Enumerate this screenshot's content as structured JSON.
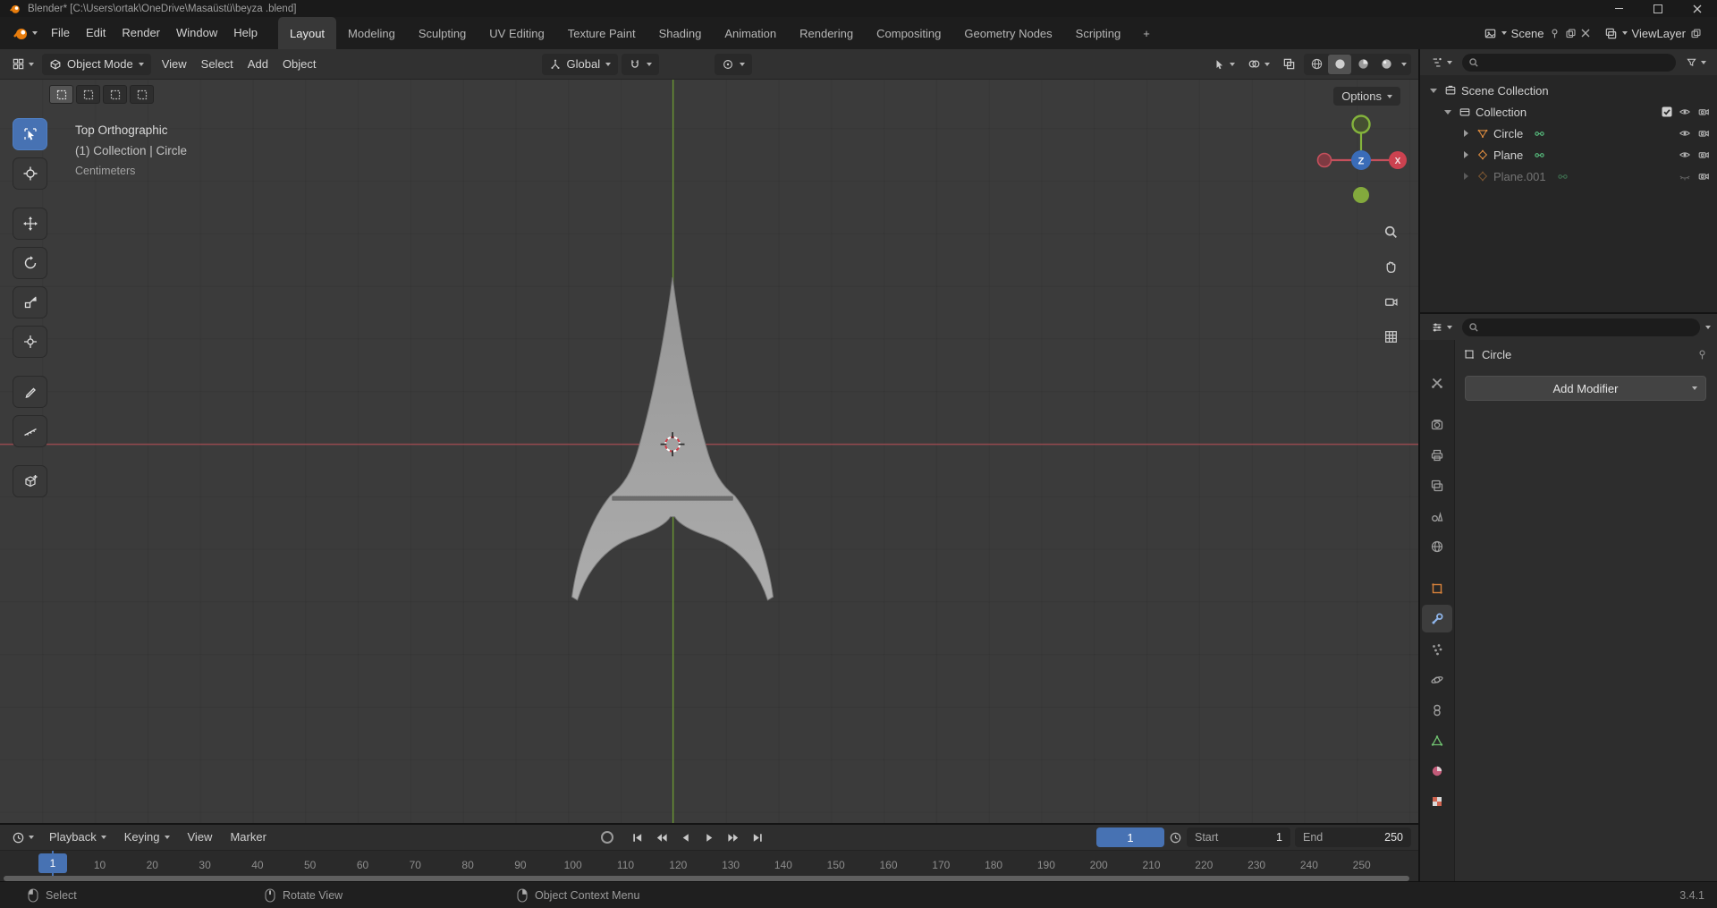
{
  "titlebar": {
    "title": "Blender* [C:\\Users\\ortak\\OneDrive\\Masaüstü\\beyza .blend]"
  },
  "topbar": {
    "menus": [
      "File",
      "Edit",
      "Render",
      "Window",
      "Help"
    ],
    "workspaces": [
      {
        "label": "Layout",
        "active": true
      },
      {
        "label": "Modeling"
      },
      {
        "label": "Sculpting"
      },
      {
        "label": "UV Editing"
      },
      {
        "label": "Texture Paint"
      },
      {
        "label": "Shading"
      },
      {
        "label": "Animation"
      },
      {
        "label": "Rendering"
      },
      {
        "label": "Compositing"
      },
      {
        "label": "Geometry Nodes"
      },
      {
        "label": "Scripting"
      }
    ],
    "add_workspace_label": "+",
    "scene_value": "Scene",
    "view_layer_value": "ViewLayer"
  },
  "viewport": {
    "header": {
      "mode": "Object Mode",
      "menus": [
        "View",
        "Select",
        "Add",
        "Object"
      ],
      "orientation": "Global",
      "options_label": "Options"
    },
    "overlay": {
      "view_name": "Top Orthographic",
      "context": "(1) Collection | Circle",
      "units": "Centimeters"
    },
    "gizmo": {
      "x_label": "X",
      "z_label": "Z"
    }
  },
  "outliner": {
    "rows": [
      {
        "label": "Scene Collection"
      },
      {
        "label": "Collection"
      },
      {
        "label": "Circle"
      },
      {
        "label": "Plane"
      },
      {
        "label": "Plane.001"
      }
    ]
  },
  "properties": {
    "object_name": "Circle",
    "add_modifier_label": "Add Modifier"
  },
  "timeline": {
    "menus": [
      "Playback",
      "Keying",
      "View",
      "Marker"
    ],
    "current_frame": "1",
    "playhead_label": "1",
    "start_label": "Start",
    "start_value": "1",
    "end_label": "End",
    "end_value": "250",
    "ticks": [
      "1",
      "10",
      "20",
      "30",
      "40",
      "50",
      "60",
      "70",
      "80",
      "90",
      "100",
      "110",
      "120",
      "130",
      "140",
      "150",
      "160",
      "170",
      "180",
      "190",
      "200",
      "210",
      "220",
      "230",
      "240",
      "250"
    ]
  },
  "statusbar": {
    "items": [
      {
        "label": "Select"
      },
      {
        "label": "Rotate View"
      },
      {
        "label": "Object Context Menu"
      }
    ],
    "version": "3.4.1"
  }
}
